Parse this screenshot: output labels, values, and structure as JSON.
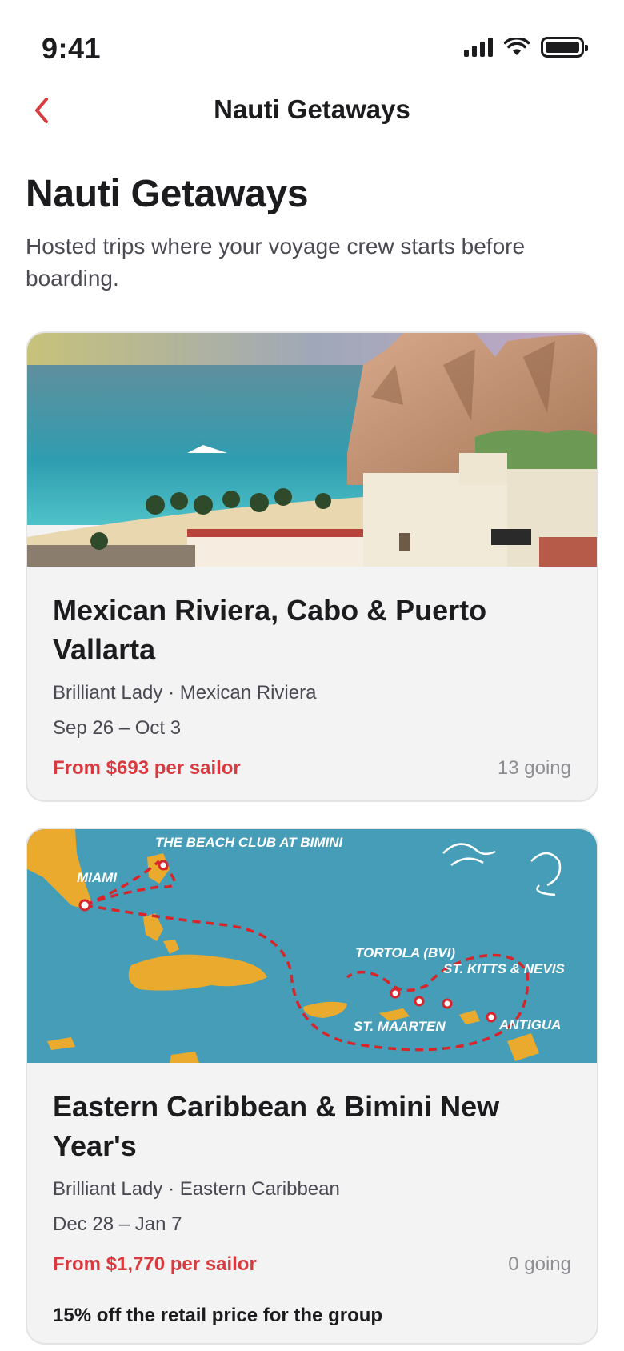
{
  "status_bar": {
    "time": "9:41",
    "icons": [
      "signal-icon",
      "wifi-icon",
      "battery-icon"
    ]
  },
  "nav": {
    "back_icon": "chevron-left-icon",
    "title": "Nauti Getaways"
  },
  "header": {
    "title": "Nauti Getaways",
    "subtitle": "Hosted trips where your voyage crew starts before boarding."
  },
  "trips": [
    {
      "title": "Mexican Riviera, Cabo & Puerto Vallarta",
      "meta": "Brilliant Lady · Mexican Riviera",
      "dates": "Sep 26 – Oct 3",
      "price": "From $693 per sailor",
      "going": "13 going"
    },
    {
      "title": "Eastern Caribbean & Bimini New Year's",
      "meta": "Brilliant Lady · Eastern Caribbean",
      "dates": "Dec 28 – Jan 7",
      "price": "From $1,770 per sailor",
      "going": "0 going",
      "discount": "15% off the retail price for the group",
      "map_labels": {
        "beach_club": "THE BEACH CLUB AT BIMINI",
        "miami": "MIAMI",
        "tortola": "TORTOLA (BVI)",
        "st_kitts": "ST. KITTS & NEVIS",
        "st_maarten": "ST. MAARTEN",
        "antigua": "ANTIGUA"
      }
    }
  ],
  "colors": {
    "accent": "#d93a3f",
    "text": "#1c1c1e",
    "secondary": "#4a4a52",
    "muted": "#8e8e93",
    "card_bg": "#f3f3f4"
  }
}
